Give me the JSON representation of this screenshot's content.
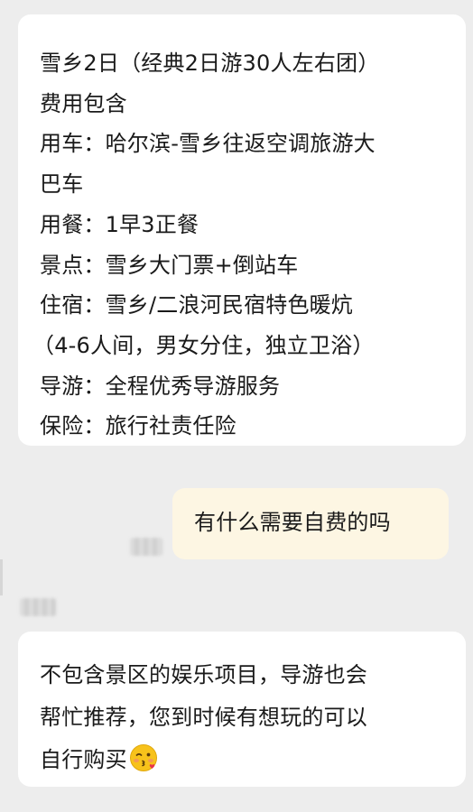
{
  "messages": {
    "package_info": {
      "lines": [
        "雪乡2日（经典2日游30人左右团）",
        "费用包含",
        "用车：哈尔滨-雪乡往返空调旅游大",
        "巴车",
        "用餐：1早3正餐",
        "景点：雪乡大门票+倒站车",
        "住宿：雪乡/二浪河民宿特色暖炕",
        "（4-6人间，男女分住，独立卫浴）",
        "导游：全程优秀导游服务",
        "保险：旅行社责任险"
      ]
    },
    "question": {
      "text": "有什么需要自费的吗"
    },
    "answer": {
      "lines": [
        "不包含景区的娱乐项目，导游也会",
        "帮忙推荐，您到时候有想玩的可以",
        "自行购买"
      ],
      "emoji": "kissing-face-emoji"
    }
  },
  "colors": {
    "background": "#ededed",
    "incoming_bubble": "#ffffff",
    "outgoing_bubble": "#fdf6e3",
    "text": "#1a1a1a"
  }
}
